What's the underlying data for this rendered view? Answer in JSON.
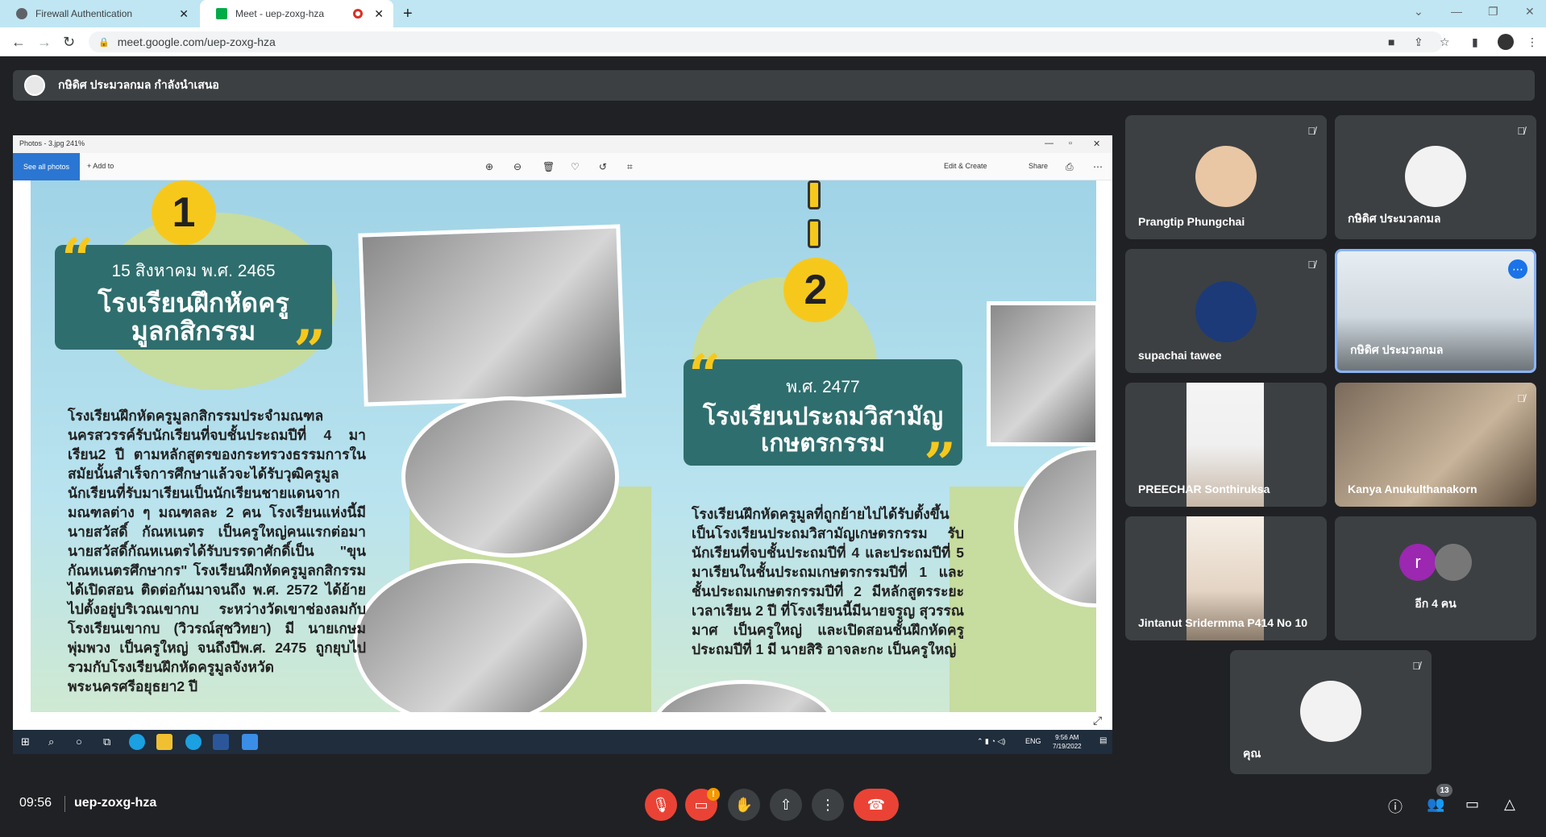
{
  "browser": {
    "tabs": [
      {
        "title": "Firewall Authentication"
      },
      {
        "title": "Meet - uep-zoxg-hza"
      }
    ],
    "url": "meet.google.com/uep-zoxg-hza"
  },
  "presenting": {
    "text": "กษิดิศ ประมวลกมล กำลังนำเสนอ"
  },
  "photos_app": {
    "title": "Photos - 3.jpg  241%",
    "see_all": "See all photos",
    "add_to": "+ Add to",
    "edit_create": "Edit & Create",
    "share": "Share"
  },
  "poster": {
    "badge1": "1",
    "badge2": "2",
    "block1": {
      "date": "15 สิงหาคม พ.ศ. 2465",
      "heading_line1": "โรงเรียนฝึกหัดครู",
      "heading_line2": "มูลกสิกรรม",
      "body": "โรงเรียนฝึกหัดครูมูลกสิกรรมประจำมณฑลนครสวรรค์รับนักเรียนที่จบชั้นประถมปีที่ 4 มาเรียน2 ปี ตามหลักสูตรของกระทรวงธรรมการในสมัยนั้นสำเร็จการศึกษาแล้วจะได้รับวุฒิครูมูลนักเรียนที่รับมาเรียนเป็นนักเรียนชายแดนจากมณฑลต่าง ๆ มณฑลละ 2 คน โรงเรียนแห่งนี้มีนายสวัสดิ์ กัณหเนตร เป็นครูใหญ่คนแรกต่อมานายสวัสดิ์กัณหเนตรได้รับบรรดาศักดิ์เป็น \"ขุนกัณหเนตรศึกษากร\" โรงเรียนฝึกหัดครูมูลกสิกรรม ได้เปิดสอน ติดต่อกันมาจนถึง พ.ศ. 2572 ได้ย้ายไปตั้งอยู่บริเวณเขากบ ระหว่างวัดเขาช่องลมกับโรงเรียนเขากบ (วิวรณ์สุชวิทยา) มี นายเกษม พุ่มพวง เป็นครูใหญ่ จนถึงปีพ.ศ. 2475 ถูกยุบไปรวมกับโรงเรียนฝึกหัดครูมูลจังหวัดพระนครศรีอยุธยา2 ปี"
    },
    "block2": {
      "date": "พ.ศ. 2477",
      "heading_line1": "โรงเรียนประถมวิสามัญ",
      "heading_line2": "เกษตรกรรม",
      "body": "โรงเรียนฝึกหัดครูมูลที่ถูกย้ายไปได้รับตั้งขึ้นเป็นโรงเรียนประถมวิสามัญเกษตรกรรม รับนักเรียนที่จบชั้นประถมปีที่ 4 และประถมปีที่ 5 มาเรียนในชั้นประถมเกษตรกรรมปีที่ 1 และชั้นประถมเกษตรกรรมปีที่ 2 มีหลักสูตรระยะเวลาเรียน 2 ปี ที่โรงเรียนนี้มีนายจรูญ สุวรรณมาศ เป็นครูใหญ่ และเปิดสอนชั้นฝึกหัดครูประถมปีที่ 1 มี นายสิริ อาจละกะ เป็นครูใหญ่"
    }
  },
  "taskbar": {
    "lang": "ENG",
    "time": "9:56 AM",
    "date": "7/19/2022"
  },
  "participants": [
    {
      "name": "Prangtip Phungchai"
    },
    {
      "name": "กษิดิศ ประมวลกมล"
    },
    {
      "name": "supachai tawee"
    },
    {
      "name": "กษิดิศ ประมวลกมล"
    },
    {
      "name": "PREECHAR Sonthiruksa"
    },
    {
      "name": "Kanya Anukulthanakorn"
    },
    {
      "name": "Jintanut Sridermma P414 No 10"
    },
    {
      "name": "อีก 4 คน",
      "initial": "r"
    },
    {
      "name": "คุณ"
    }
  ],
  "meeting": {
    "time": "09:56",
    "code": "uep-zoxg-hza",
    "participant_count": "13"
  },
  "colors": {
    "background": "#202124",
    "tile": "#3c4043",
    "end_call": "#ea4335",
    "accent": "#1a73e8"
  }
}
